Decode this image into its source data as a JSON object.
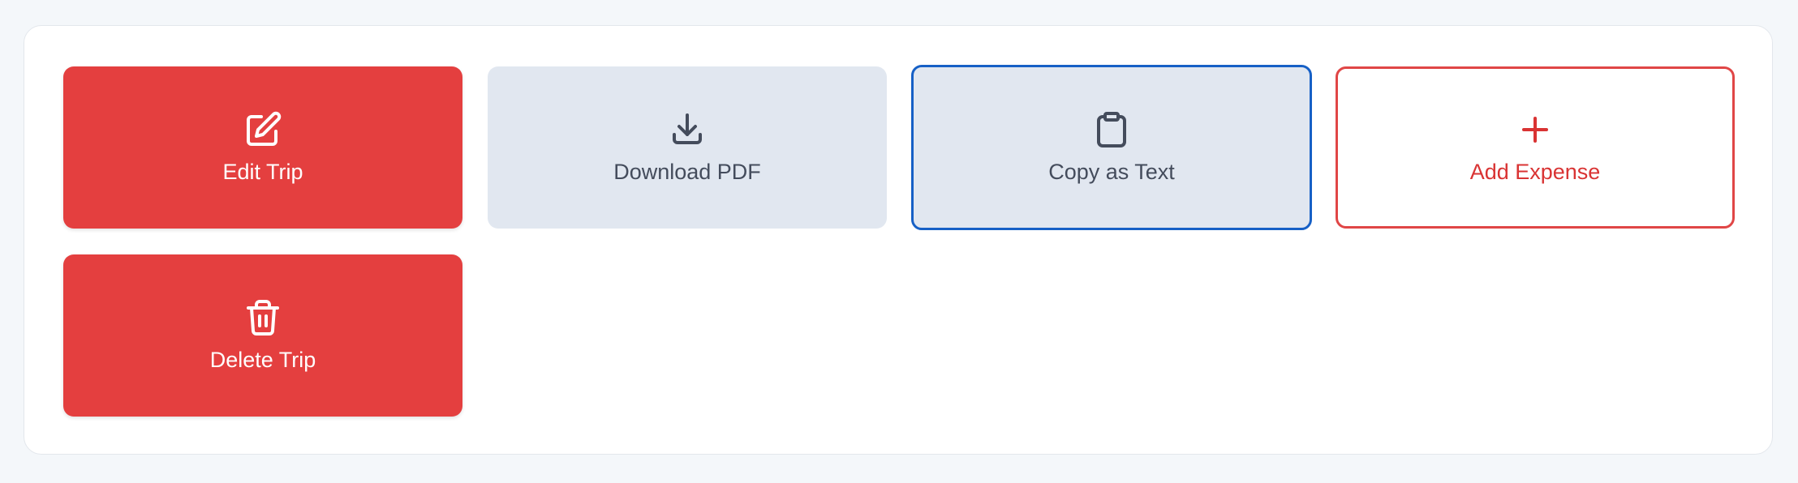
{
  "actions": {
    "edit_trip": {
      "label": "Edit Trip",
      "icon": "edit-icon"
    },
    "download_pdf": {
      "label": "Download PDF",
      "icon": "download-icon"
    },
    "copy_as_text": {
      "label": "Copy as Text",
      "icon": "clipboard-icon"
    },
    "add_expense": {
      "label": "Add Expense",
      "icon": "plus-icon"
    },
    "delete_trip": {
      "label": "Delete Trip",
      "icon": "trash-icon"
    }
  },
  "colors": {
    "page_background": "#f4f7fa",
    "panel_background": "#ffffff",
    "danger": "#e43f3f",
    "neutral_button": "#e1e7f0",
    "neutral_text": "#444c5c",
    "focus_outline": "#1660c6",
    "outline_red": "#e04646"
  }
}
